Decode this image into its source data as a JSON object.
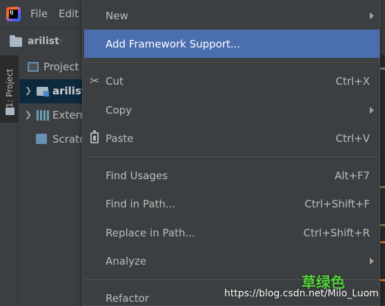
{
  "menubar": {
    "file_label": "File",
    "edit_label": "Edit"
  },
  "navbar": {
    "project_name": "arilist"
  },
  "side_tab": {
    "label": "1: Project"
  },
  "project_tree": {
    "header_label": "Project",
    "items": [
      {
        "label": "arilist"
      },
      {
        "label": "Extern"
      },
      {
        "label": "Scratc"
      }
    ]
  },
  "context_menu": {
    "items": [
      {
        "label": "New",
        "shortcut": "",
        "submenu": true
      },
      {
        "label": "Add Framework Support...",
        "shortcut": "",
        "selected": true
      },
      {
        "label": "Cut",
        "shortcut": "Ctrl+X",
        "icon": "scissors-icon"
      },
      {
        "label": "Copy",
        "shortcut": "",
        "submenu": true
      },
      {
        "label": "Paste",
        "shortcut": "Ctrl+V",
        "icon": "clipboard-paste-icon"
      },
      {
        "label": "Find Usages",
        "shortcut": "Alt+F7"
      },
      {
        "label": "Find in Path...",
        "shortcut": "Ctrl+Shift+F"
      },
      {
        "label": "Replace in Path...",
        "shortcut": "Ctrl+Shift+R"
      },
      {
        "label": "Analyze",
        "shortcut": "",
        "submenu": true
      },
      {
        "label": "Refactor",
        "shortcut": ""
      }
    ]
  },
  "watermark": {
    "url": "https://blog.csdn.net/Milo_Luom",
    "brand": "草绿色"
  },
  "colors": {
    "selection": "#4b6eaf",
    "menu_bg": "#3c3f41",
    "text": "#bbbbbb",
    "brand_green": "#52d13a"
  }
}
